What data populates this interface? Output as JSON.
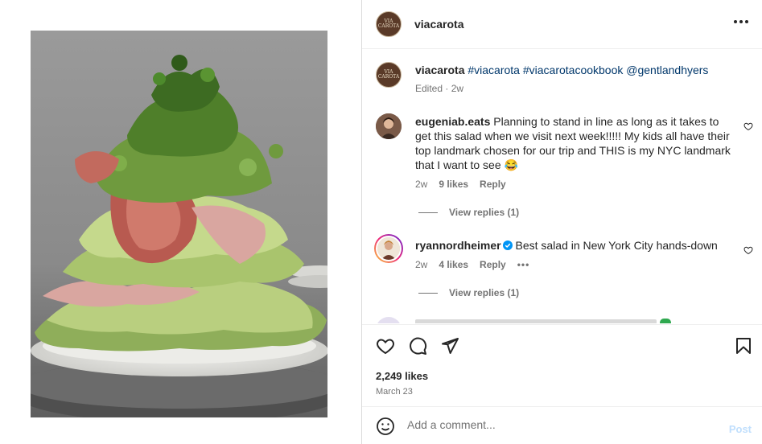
{
  "post": {
    "author": "viacarota",
    "brand_logo_text": "VIA CAROTA",
    "more_icon": "more-horizontal-icon"
  },
  "caption": {
    "author": "viacarota",
    "tags": "#viacarota #viacarotacookbook @gentlandhyers",
    "meta": "Edited · 2w"
  },
  "comments": [
    {
      "author": "eugeniab.eats",
      "text": "Planning to stand in line as long as it takes to get this salad when we visit next week!!!!! My kids all have their top landmark chosen for our trip and THIS is my NYC landmark that I want to see 😂",
      "time": "2w",
      "likes": "9 likes",
      "reply": "Reply",
      "view_replies": "View replies (1)"
    },
    {
      "author": "ryannordheimer",
      "text": "Best salad in New York City hands-down",
      "time": "2w",
      "likes": "4 likes",
      "reply": "Reply",
      "options": "•••",
      "view_replies": "View replies (1)"
    }
  ],
  "actions": {
    "likes": "2,249 likes",
    "date": "March 23"
  },
  "add_comment": {
    "placeholder": "Add a comment...",
    "post_label": "Post"
  },
  "colors": {
    "link": "#00376b",
    "muted": "#737373",
    "post_disabled": "#c0dffd"
  }
}
